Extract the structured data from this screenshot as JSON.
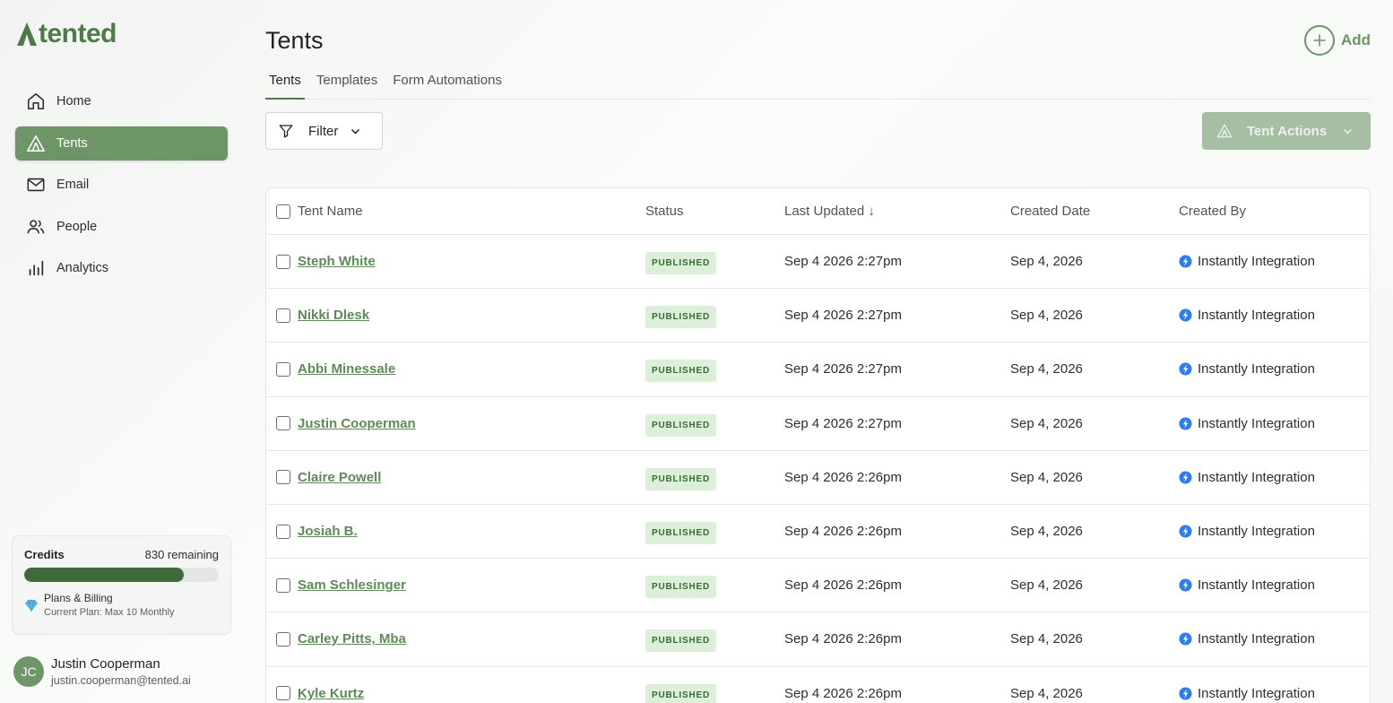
{
  "brand": {
    "name": "tented",
    "color": "#4d7a48"
  },
  "nav": [
    {
      "label": "Home",
      "icon": "home-icon",
      "active": false
    },
    {
      "label": "Tents",
      "icon": "tent-icon",
      "active": true
    },
    {
      "label": "Email",
      "icon": "mail-icon",
      "active": false
    },
    {
      "label": "People",
      "icon": "people-icon",
      "active": false
    },
    {
      "label": "Analytics",
      "icon": "bar-chart-icon",
      "active": false
    }
  ],
  "credits": {
    "title": "Credits",
    "remaining": "830 remaining",
    "progress_fraction": 0.82,
    "billing_title": "Plans & Billing",
    "billing_plan": "Current Plan: Max 10 Monthly"
  },
  "user": {
    "initials": "JC",
    "name": "Justin Cooperman",
    "email": "justin.cooperman@tented.ai"
  },
  "page": {
    "title": "Tents",
    "add_label": "Add"
  },
  "tabs": [
    {
      "label": "Tents",
      "active": true
    },
    {
      "label": "Templates",
      "active": false
    },
    {
      "label": "Form Automations",
      "active": false
    }
  ],
  "toolbar": {
    "filter_label": "Filter",
    "actions_label": "Tent Actions"
  },
  "table": {
    "columns": {
      "name": "Tent Name",
      "status": "Status",
      "updated": "Last Updated ↓",
      "created": "Created Date",
      "by": "Created By"
    },
    "rows": [
      {
        "name": "Steph White",
        "status": "PUBLISHED",
        "updated": "Sep 4 2026 2:27pm",
        "created": "Sep 4, 2026",
        "by": "Instantly Integration"
      },
      {
        "name": "Nikki Dlesk",
        "status": "PUBLISHED",
        "updated": "Sep 4 2026 2:27pm",
        "created": "Sep 4, 2026",
        "by": "Instantly Integration"
      },
      {
        "name": "Abbi Minessale",
        "status": "PUBLISHED",
        "updated": "Sep 4 2026 2:27pm",
        "created": "Sep 4, 2026",
        "by": "Instantly Integration"
      },
      {
        "name": "Justin Cooperman",
        "status": "PUBLISHED",
        "updated": "Sep 4 2026 2:27pm",
        "created": "Sep 4, 2026",
        "by": "Instantly Integration"
      },
      {
        "name": "Claire Powell",
        "status": "PUBLISHED",
        "updated": "Sep 4 2026 2:26pm",
        "created": "Sep 4, 2026",
        "by": "Instantly Integration"
      },
      {
        "name": "Josiah B.",
        "status": "PUBLISHED",
        "updated": "Sep 4 2026 2:26pm",
        "created": "Sep 4, 2026",
        "by": "Instantly Integration"
      },
      {
        "name": "Sam Schlesinger",
        "status": "PUBLISHED",
        "updated": "Sep 4 2026 2:26pm",
        "created": "Sep 4, 2026",
        "by": "Instantly Integration"
      },
      {
        "name": "Carley Pitts, Mba",
        "status": "PUBLISHED",
        "updated": "Sep 4 2026 2:26pm",
        "created": "Sep 4, 2026",
        "by": "Instantly Integration"
      },
      {
        "name": "Kyle Kurtz",
        "status": "PUBLISHED",
        "updated": "Sep 4 2026 2:26pm",
        "created": "Sep 4, 2026",
        "by": "Instantly Integration"
      }
    ]
  }
}
